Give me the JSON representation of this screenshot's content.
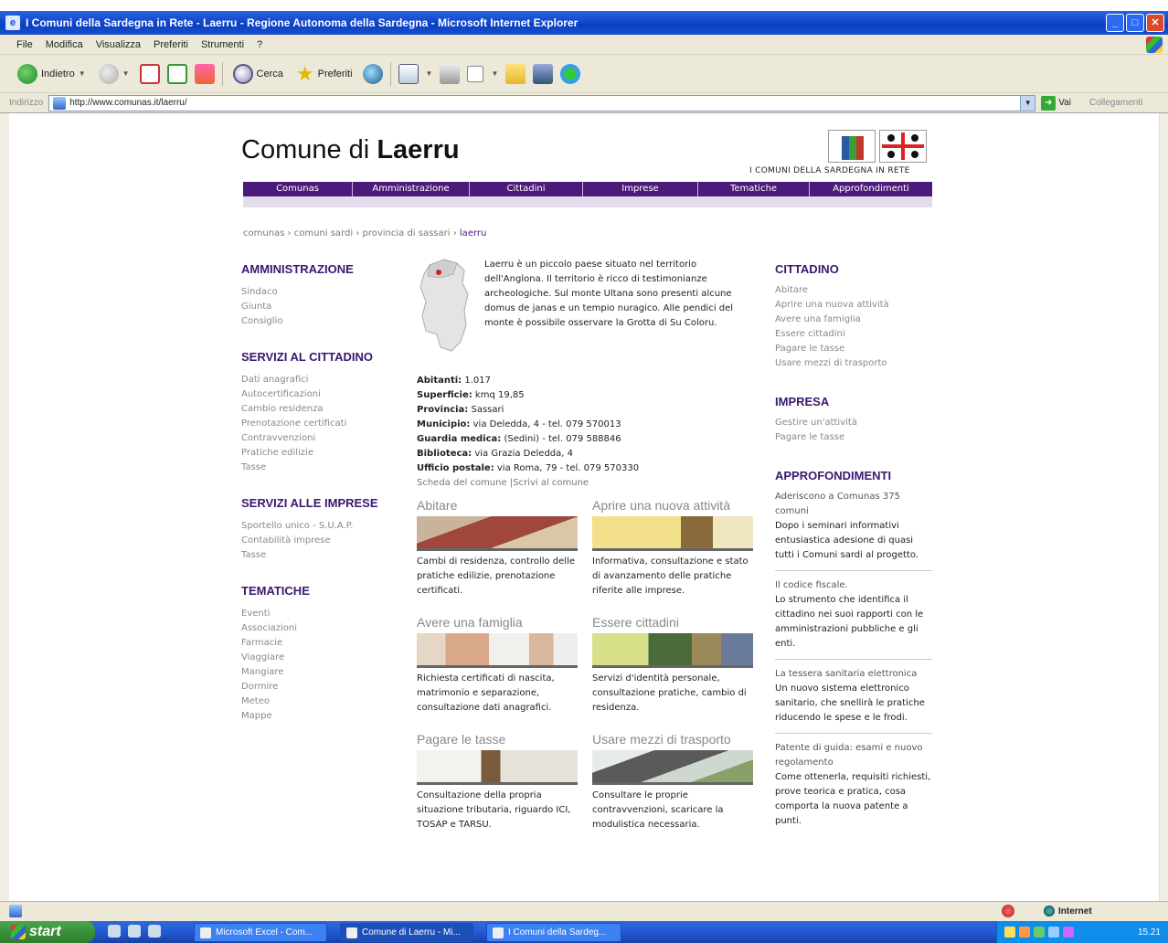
{
  "window": {
    "title": "I Comuni della Sardegna in Rete - Laerru - Regione Autonoma della Sardegna - Microsoft Internet Explorer"
  },
  "menubar": [
    "File",
    "Modifica",
    "Visualizza",
    "Preferiti",
    "Strumenti",
    "?"
  ],
  "toolbar": {
    "back_label": "Indietro",
    "search_label": "Cerca",
    "favorites_label": "Preferiti"
  },
  "addressbar": {
    "label": "Indirizzo",
    "url": "http://www.comunas.it/laerru/",
    "go_label": "Vai",
    "links_label": "Collegamenti"
  },
  "site": {
    "title_prefix": "Comune di ",
    "title_name": "Laerru",
    "logo_caption": "I COMUNI DELLA SARDEGNA IN RETE",
    "nav": [
      "Comunas",
      "Amministrazione",
      "Cittadini",
      "Imprese",
      "Tematiche",
      "Approfondimenti"
    ],
    "breadcrumb": [
      "comunas",
      "comuni sardi",
      "provincia di sassari",
      "laerru"
    ],
    "breadcrumb_sep": " › "
  },
  "left": {
    "amministrazione": {
      "title": "AMMINISTRAZIONE",
      "links": [
        "Sindaco",
        "Giunta",
        "Consiglio"
      ]
    },
    "servizi_cittadino": {
      "title": "SERVIZI AL CITTADINO",
      "links": [
        "Dati anagrafici",
        "Autocertificazioni",
        "Cambio residenza",
        "Prenotazione certificati",
        "Contravvenzioni",
        "Pratiche edilizie",
        "Tasse"
      ]
    },
    "servizi_imprese": {
      "title": "SERVIZI ALLE IMPRESE",
      "links": [
        "Sportello unico - S.U.A.P.",
        "Contabilità imprese",
        "Tasse"
      ]
    },
    "tematiche": {
      "title": "TEMATICHE",
      "links": [
        "Eventi",
        "Associazioni",
        "Farmacie",
        "Viaggiare",
        "Mangiare",
        "Dormire",
        "Meteo",
        "Mappe"
      ]
    }
  },
  "center": {
    "intro": "Laerru è un piccolo paese situato nel territorio dell'Anglona. Il territorio è ricco di testimonianze archeologiche. Sul monte Ultana sono presenti alcune domus de janas e un tempio nuragico. Alle pendici del monte è possibile osservare la Grotta di Su Coloru.",
    "facts": [
      {
        "label": "Abitanti:",
        "value": " 1.017"
      },
      {
        "label": "Superficie:",
        "value": " kmq 19,85"
      },
      {
        "label": "Provincia:",
        "value": " Sassari"
      },
      {
        "label": "Municipio:",
        "value": " via Deledda, 4 - tel. 079 570013"
      },
      {
        "label": "Guardia medica:",
        "value": " (Sedini) - tel. 079 588846"
      },
      {
        "label": "Biblioteca:",
        "value": " via Grazia Deledda, 4"
      },
      {
        "label": "Ufficio postale:",
        "value": " via Roma, 79 - tel. 079 570330"
      }
    ],
    "fact_links": [
      "Scheda del comune",
      "Scrivi al comune"
    ],
    "fact_links_sep": " |",
    "cards": [
      {
        "title": "Abitare",
        "desc": "Cambi di residenza, controllo delle pratiche edilizie, prenotazione certificati."
      },
      {
        "title": "Aprire una nuova attività",
        "desc": "Informativa, consultazione e stato di avanzamento delle pratiche riferite alle imprese."
      },
      {
        "title": "Avere una famiglia",
        "desc": "Richiesta certificati di nascita, matrimonio e separazione, consultazione dati anagrafici."
      },
      {
        "title": "Essere cittadini",
        "desc": "Servizi d'identità personale, consultazione pratiche, cambio di residenza."
      },
      {
        "title": "Pagare le tasse",
        "desc": "Consultazione della propria situazione tributaria, riguardo ICI, TOSAP e TARSU."
      },
      {
        "title": "Usare mezzi di trasporto",
        "desc": "Consultare le proprie contravvenzioni, scaricare la modulistica necessaria."
      }
    ]
  },
  "right": {
    "cittadino": {
      "title": "CITTADINO",
      "links": [
        "Abitare",
        "Aprire una nuova attività",
        "Avere una famiglia",
        "Essere cittadini",
        "Pagare le tasse",
        "Usare mezzi di trasporto"
      ]
    },
    "impresa": {
      "title": "IMPRESA",
      "links": [
        "Gestire un'attività",
        "Pagare le tasse"
      ]
    },
    "approfondimenti": {
      "title": "APPROFONDIMENTI",
      "news": [
        {
          "title": "Aderiscono a Comunas 375 comuni",
          "body": "Dopo i seminari informativi entusiastica adesione di quasi tutti i Comuni sardi al progetto."
        },
        {
          "title": "Il codice fiscale.",
          "body": "Lo strumento che identifica il cittadino nei suoi rapporti con le amministrazioni pubbliche e gli enti."
        },
        {
          "title": "La tessera sanitaria elettronica",
          "body": "Un nuovo sistema elettronico sanitario, che snellirà le pratiche riducendo le spese e le frodi."
        },
        {
          "title": "Patente di guida: esami e nuovo regolamento",
          "body": "Come ottenerla, requisiti richiesti, prove teorica e pratica, cosa comporta la nuova patente a punti."
        }
      ]
    }
  },
  "statusbar": {
    "zone": "Internet"
  },
  "taskbar": {
    "start": "start",
    "tasks": [
      "Microsoft Excel - Com...",
      "Comune di Laerru - Mi...",
      "I Comuni della Sardeg..."
    ],
    "clock": "15.21"
  }
}
